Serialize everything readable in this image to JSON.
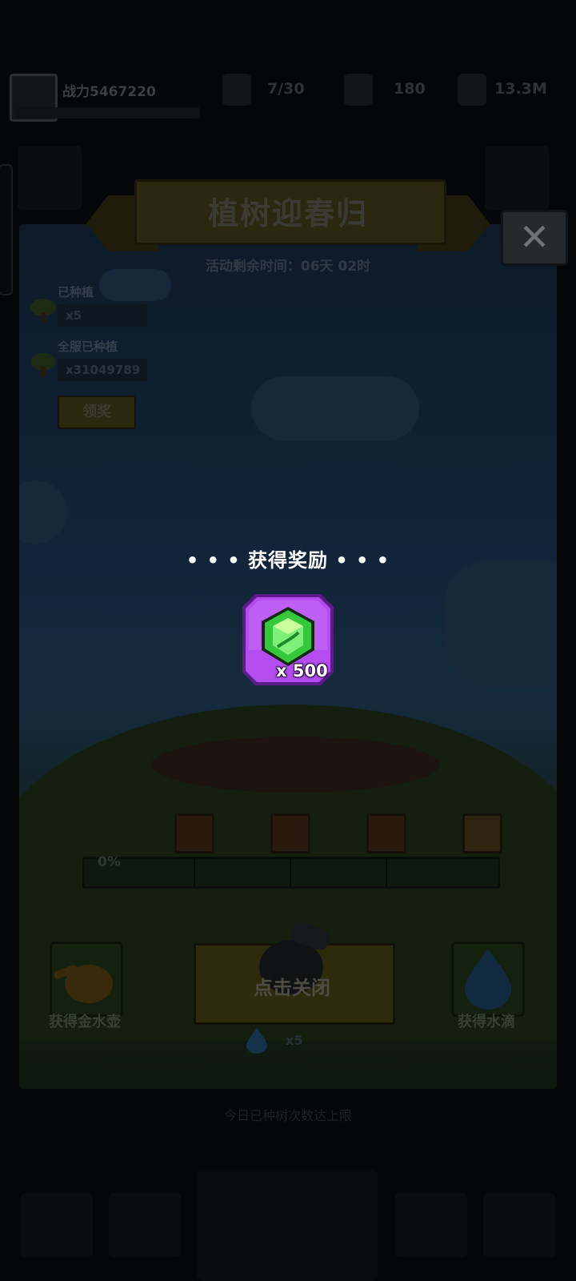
{
  "topbar": {
    "combat_power": "战力5467220",
    "resources": [
      {
        "icon": "energy-icon",
        "value": "7/30"
      },
      {
        "icon": "clover-icon",
        "value": "180"
      },
      {
        "icon": "bean-icon",
        "value": "13.3M"
      }
    ]
  },
  "event": {
    "title": "植树迎春归",
    "timer": "活动剩余时间：06天 02时",
    "planted_label": "已种植",
    "planted_value": "x5",
    "server_planted_label": "全服已种植",
    "server_planted_value": "x31049789",
    "claim_button": "领奖",
    "progress_text": "0%",
    "progress": 0,
    "chest_count": 4,
    "left_button_label": "获得金水壶",
    "right_button_label": "获得水滴",
    "drop_count": "x5",
    "close_icon": "close-icon"
  },
  "reward_popup": {
    "title": "• • •  获得奖励  • • •",
    "item_icon": "green-gem-icon",
    "item_quantity": "x 500",
    "close_hint": "点击关闭"
  },
  "footer": {
    "hint": "今日已种树次数达上限"
  },
  "colors": {
    "overlay": "#050607",
    "reward_frame": "#b44cf0",
    "gem": "#34c83a"
  }
}
